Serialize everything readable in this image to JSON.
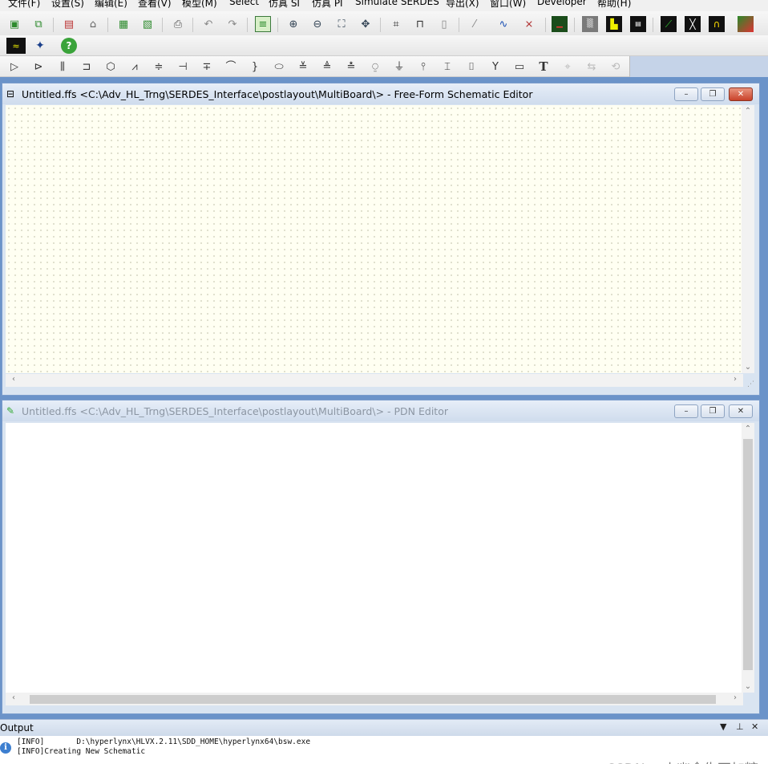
{
  "menu": [
    {
      "label": "文件(F)"
    },
    {
      "label": "设置(S)"
    },
    {
      "label": "编辑(E)"
    },
    {
      "label": "查看(V)"
    },
    {
      "label": "模型(M)"
    },
    {
      "label": "Select"
    },
    {
      "label": "仿真 SI"
    },
    {
      "label": "仿真 PI"
    },
    {
      "label": "Simulate SERDES"
    },
    {
      "label": "导出(X)"
    },
    {
      "label": "窗口(W)"
    },
    {
      "label": "Developer"
    },
    {
      "label": "帮助(H)"
    }
  ],
  "toolbar": {
    "help_glyph": "?",
    "text_tool_glyph": "T"
  },
  "schematic_window": {
    "title": "Untitled.ffs  <C:\\Adv_HL_Trng\\SERDES_Interface\\postlayout\\MultiBoard\\> - Free-Form Schematic Editor",
    "minimize": "–",
    "restore": "❐",
    "close": "✕"
  },
  "pdn_window": {
    "title": "Untitled.ffs  <C:\\Adv_HL_Trng\\SERDES_Interface\\postlayout\\MultiBoard\\> - PDN Editor",
    "minimize": "–",
    "restore": "❐",
    "close": "✕"
  },
  "output": {
    "title": "Output",
    "info_glyph": "i",
    "lines": [
      "[INFO]       D:\\hyperlynx\\HLVX.2.11\\SDD_HOME\\hyperlynx64\\bsw.exe",
      "[INFO]Creating New Schematic"
    ],
    "dropdown_glyph": "▼",
    "pin_glyph": "⊥",
    "close_glyph": "✕"
  },
  "watermark": "CSDN @小幽余生不加糖"
}
